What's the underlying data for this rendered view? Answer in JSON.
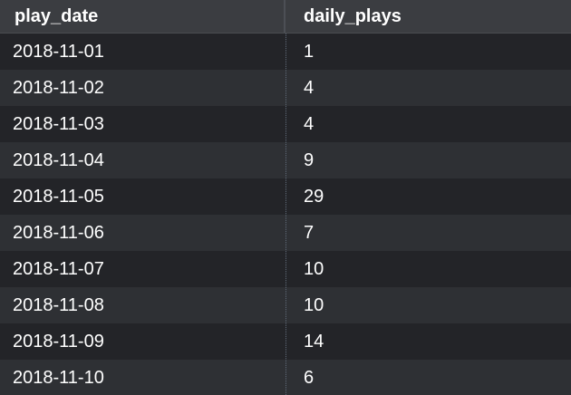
{
  "table": {
    "columns": [
      "play_date",
      "daily_plays"
    ],
    "rows": [
      [
        "2018-11-01",
        "1"
      ],
      [
        "2018-11-02",
        "4"
      ],
      [
        "2018-11-03",
        "4"
      ],
      [
        "2018-11-04",
        "9"
      ],
      [
        "2018-11-05",
        "29"
      ],
      [
        "2018-11-06",
        "7"
      ],
      [
        "2018-11-07",
        "10"
      ],
      [
        "2018-11-08",
        "10"
      ],
      [
        "2018-11-09",
        "14"
      ],
      [
        "2018-11-10",
        "6"
      ]
    ]
  },
  "colors": {
    "header_bg": "#3b3d41",
    "row_odd_bg": "#232428",
    "row_even_bg": "#2e3034",
    "text": "#ffffff"
  }
}
